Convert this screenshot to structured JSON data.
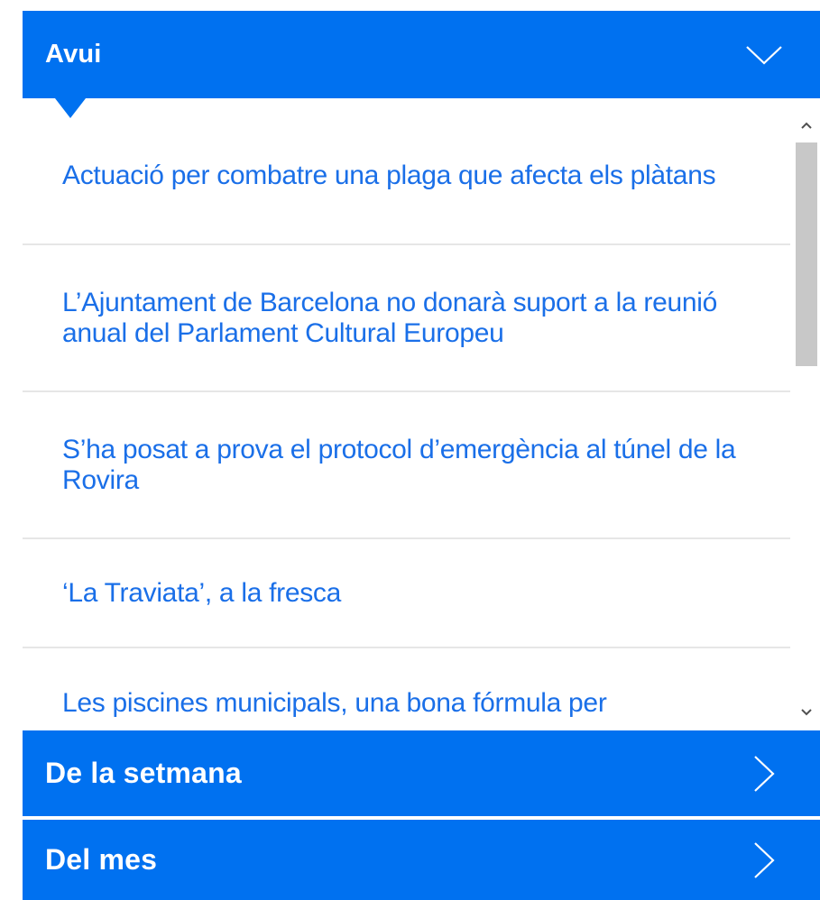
{
  "sections": {
    "today": {
      "title": "Avui",
      "icon": "chevron-down-icon",
      "expanded": true
    },
    "week": {
      "title": "De la setmana",
      "icon": "chevron-right-icon",
      "expanded": false
    },
    "month": {
      "title": "Del mes",
      "icon": "chevron-right-icon",
      "expanded": false
    }
  },
  "news": [
    "Actuació per combatre una plaga que afecta els plàtans",
    "L’Ajuntament de Barcelona no donarà suport a la reunió anual del Parlament Cultural Europeu",
    "S’ha posat a prova el protocol d’emergència al túnel de la Rovira",
    "‘La Traviata’, a la fresca",
    "Les piscines municipals, una bona fórmula per"
  ],
  "scrollbar": {
    "up": "^",
    "down": "v",
    "position": 0.0
  },
  "colors": {
    "accent": "#0071f0",
    "link": "#1a6fe8",
    "divider": "#e6e6e6"
  }
}
